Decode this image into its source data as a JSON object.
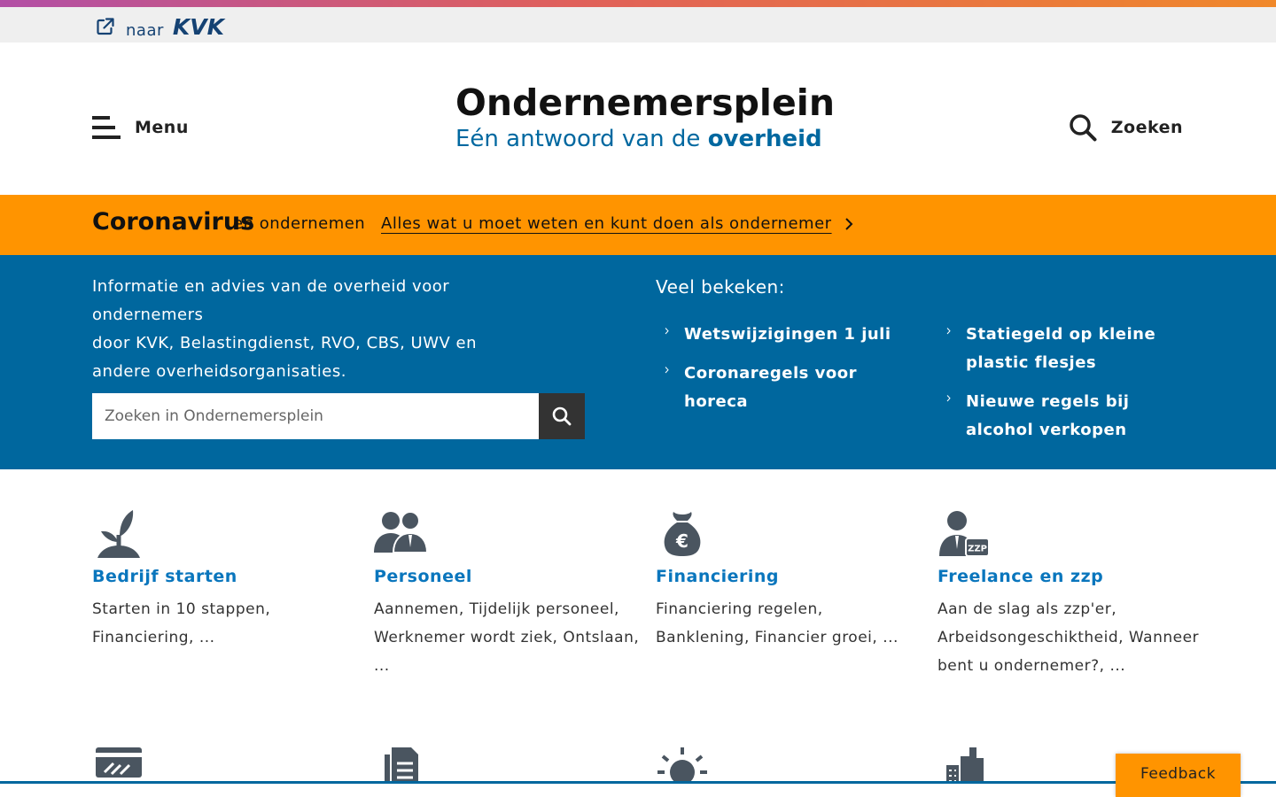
{
  "topbar": {
    "naar": "naar",
    "kvk_logo": "KVK"
  },
  "header": {
    "menu_label": "Menu",
    "title": "Ondernemersplein",
    "subtitle_plain": "Eén antwoord van de",
    "subtitle_bold": "overheid",
    "search_label": "Zoeken"
  },
  "corona": {
    "title": "Coronavirus",
    "subtitle": "en ondernemen",
    "link": "Alles wat u moet weten en kunt doen als ondernemer"
  },
  "hero": {
    "intro_line1": "Informatie en advies van de overheid voor ondernemers",
    "intro_line2": "door KVK, Belastingdienst, RVO, CBS, UWV en",
    "intro_line3": "andere overheidsorganisaties.",
    "search_placeholder": "Zoeken in Ondernemersplein",
    "viewed_title": "Veel bekeken:",
    "viewed_col1": [
      "Wetswijzigingen 1 juli",
      "Coronaregels voor horeca"
    ],
    "viewed_col2": [
      "Statiegeld op kleine plastic flesjes",
      "Nieuwe regels bij alcohol verkopen"
    ]
  },
  "tiles": [
    {
      "title": "Bedrijf starten",
      "desc": "Starten in 10 stappen, Financiering, ..."
    },
    {
      "title": "Personeel",
      "desc": "Aannemen, Tijdelijk personeel, Werknemer wordt ziek, Ontslaan, ..."
    },
    {
      "title": "Financiering",
      "desc": "Financiering regelen, Banklening, Financier groei, ..."
    },
    {
      "title": "Freelance en zzp",
      "desc": "Aan de slag als zzp'er, Arbeidsongeschiktheid, Wanneer bent u ondernemer?, ..."
    }
  ],
  "icons": {
    "euro": "€",
    "zzp": "ZZP"
  },
  "feedback": "Feedback",
  "colors": {
    "blue": "#00679e",
    "orange": "#ff9400",
    "link_blue": "#0a76bd",
    "dark_icon": "#4a5560"
  }
}
